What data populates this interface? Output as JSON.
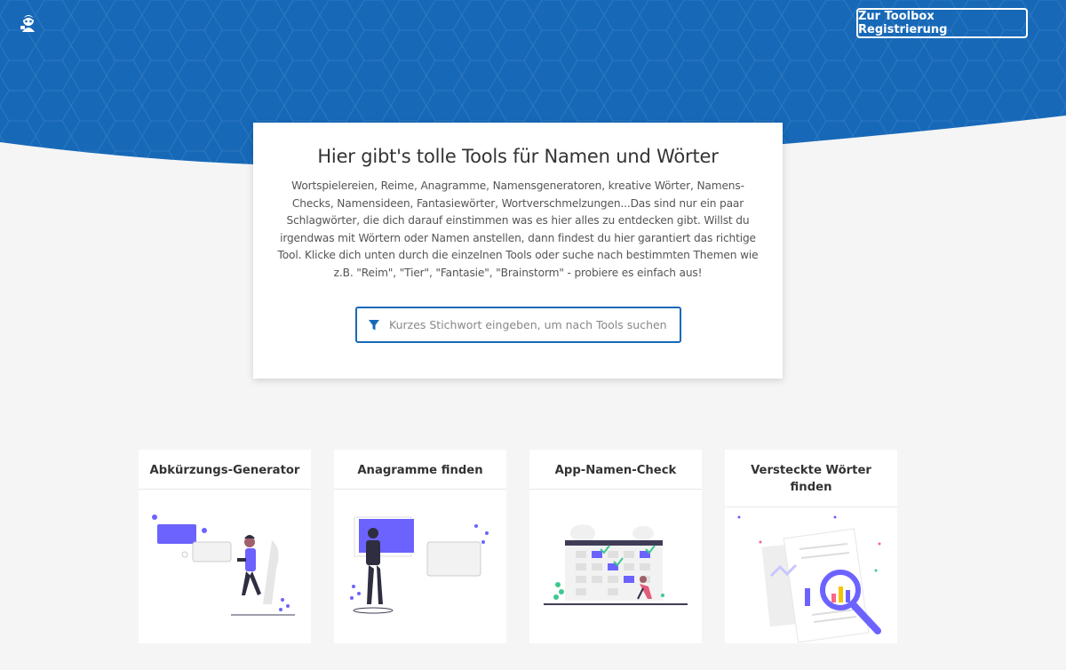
{
  "header": {
    "logo_icon": "mascot-logo-icon",
    "register_label": "Zur Toolbox Registrierung",
    "brand_color": "#1769b8"
  },
  "intro": {
    "title": "Hier gibt's tolle Tools für Namen und Wörter",
    "description": "Wortspielereien, Reime, Anagramme, Namensgeneratoren, kreative Wörter, Namens-Checks, Namensideen, Fantasiewörter, Wortverschmelzungen...Das sind nur ein paar Schlagwörter, die dich darauf einstimmen was es hier alles zu entdecken gibt. Willst du irgendwas mit Wörtern oder Namen anstellen, dann findest du hier garantiert das richtige Tool. Klicke dich unten durch die einzelnen Tools oder suche nach bestimmten Themen wie z.B. \"Reim\", \"Tier\", \"Fantasie\", \"Brainstorm\" - probiere es einfach aus!",
    "search": {
      "icon": "filter-icon",
      "placeholder": "Kurzes Stichwort eingeben, um nach Tools suchen",
      "value": ""
    }
  },
  "tools": [
    {
      "title": "Abkürzungs-Generator",
      "illustration": "person-with-phone-illustration"
    },
    {
      "title": "Anagramme finden",
      "illustration": "person-at-board-illustration"
    },
    {
      "title": "App-Namen-Check",
      "illustration": "calendar-check-illustration"
    },
    {
      "title": "Versteckte Wörter finden",
      "illustration": "magnifier-documents-illustration"
    }
  ],
  "colors": {
    "accent_purple": "#6c63ff",
    "dark_figure": "#2f2e41",
    "check_green": "#3ec98f"
  }
}
